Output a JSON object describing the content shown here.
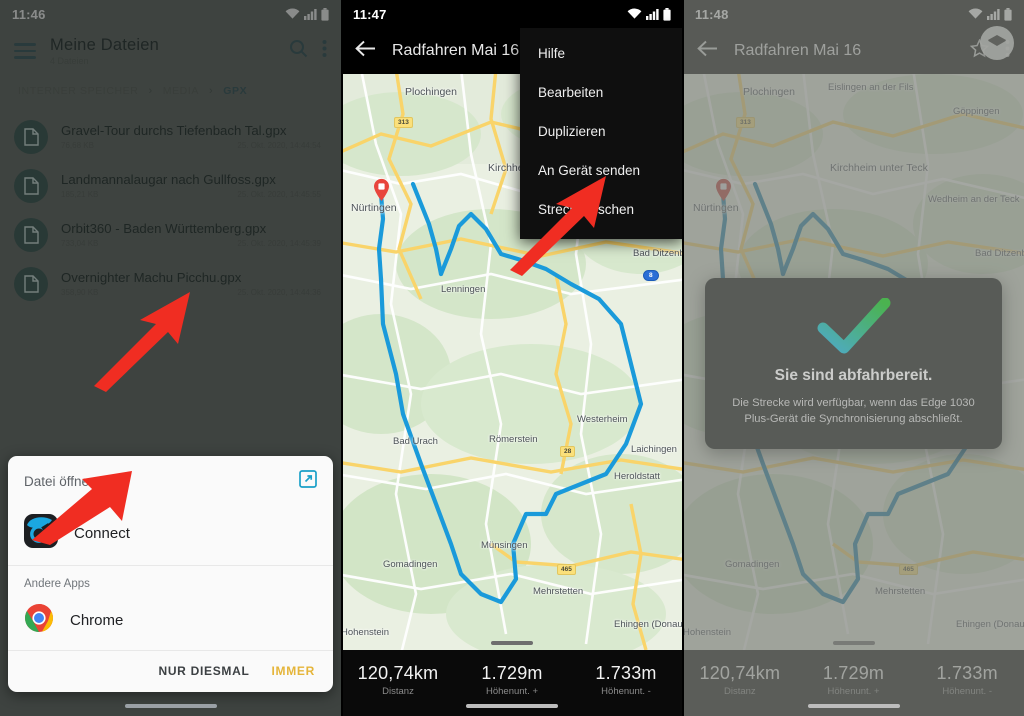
{
  "panel1": {
    "status": {
      "time": "11:46"
    },
    "appbar": {
      "title": "Meine Dateien",
      "subtitle": "4 Dateien",
      "menu_icon": "hamburger-icon",
      "search_icon": "search-icon",
      "overflow_icon": "overflow-menu-icon"
    },
    "breadcrumb": [
      {
        "label": "INTERNER SPEICHER",
        "active": false
      },
      {
        "label": "MEDIA",
        "active": false
      },
      {
        "label": "GPX",
        "active": true
      }
    ],
    "files": [
      {
        "name": "Gravel-Tour durchs Tiefenbach Tal.gpx",
        "size": "76,68 KB",
        "date": "25. Okt. 2020, 14:44:54"
      },
      {
        "name": "Landmannalaugar nach Gullfoss.gpx",
        "size": "185,21 KB",
        "date": "25. Okt. 2020, 14:45:55"
      },
      {
        "name": "Orbit360 - Baden Württemberg.gpx",
        "size": "733,04 KB",
        "date": "25. Okt. 2020, 14:45:39"
      },
      {
        "name": "Overnighter Machu Picchu.gpx",
        "size": "358,90 KB",
        "date": "25. Okt. 2020, 14:44:36"
      }
    ],
    "share_sheet": {
      "title": "Datei öffnen mit...",
      "expand_icon": "open-external-icon",
      "primary_app": {
        "label": "Connect",
        "icon": "garmin-connect-icon"
      },
      "section_label": "Andere Apps",
      "other_apps": [
        {
          "label": "Chrome",
          "icon": "chrome-icon"
        }
      ],
      "once_button": "NUR DIESMAL",
      "always_button": "IMMER",
      "accent_color": "#e5b53a"
    }
  },
  "panel2": {
    "status": {
      "time": "11:47"
    },
    "appbar": {
      "back_icon": "back-arrow-icon",
      "title": "Radfahren Mai 16"
    },
    "menu": [
      {
        "label": "Hilfe"
      },
      {
        "label": "Bearbeiten"
      },
      {
        "label": "Duplizieren"
      },
      {
        "label": "An Gerät senden"
      },
      {
        "label": "Strecke löschen"
      }
    ],
    "map_labels": [
      "Plochingen",
      "Kirchheim unter Teck",
      "Nürtingen",
      "Lenningen",
      "Bad Ditzenbach",
      "Westerheim",
      "Laichingen",
      "Bad Urach",
      "Römerstein",
      "Heroldstatt",
      "Münsingen",
      "Gomadingen",
      "Mehrstetten",
      "Hohenstein",
      "Ehingen (Donau)"
    ],
    "road_shields": [
      "313",
      "28",
      "465",
      "8"
    ],
    "stats": [
      {
        "value": "120,74km",
        "label": "Distanz"
      },
      {
        "value": "1.729m",
        "label": "Höhenunt. +"
      },
      {
        "value": "1.733m",
        "label": "Höhenunt. -"
      }
    ],
    "route_color": "#1a9ada"
  },
  "panel3": {
    "status": {
      "time": "11:48"
    },
    "appbar": {
      "back_icon": "back-arrow-icon",
      "title": "Radfahren Mai 16",
      "star_icon": "star-outline-icon",
      "overflow_icon": "overflow-menu-icon"
    },
    "layers_icon": "map-layers-icon",
    "map_labels": [
      "Plochingen",
      "Eislingen an der Fils",
      "Göppingen",
      "Kirchheim unter Teck",
      "Nürtingen",
      "Wedheim an der Teck",
      "Bad Ditzenbach",
      "Gomadingen",
      "Mehrstetten",
      "Hohenstein",
      "Ehingen (Donau)"
    ],
    "dialog": {
      "icon": "success-check-icon",
      "title": "Sie sind abfahrbereit.",
      "body": "Die Strecke wird verfügbar, wenn das Edge 1030 Plus-Gerät die Synchronisierung abschließt.",
      "check_color_start": "#29c5f6",
      "check_color_end": "#23d42b"
    },
    "stats": [
      {
        "value": "120,74km",
        "label": "Distanz"
      },
      {
        "value": "1.729m",
        "label": "Höhenunt. +"
      },
      {
        "value": "1.733m",
        "label": "Höhenunt. -"
      }
    ]
  },
  "annotations": {
    "arrow_color": "#f02d22",
    "arrows": [
      {
        "name": "arrow-to-machu-picchu-file"
      },
      {
        "name": "arrow-to-connect-app"
      },
      {
        "name": "arrow-to-an-geraet-senden"
      }
    ]
  }
}
